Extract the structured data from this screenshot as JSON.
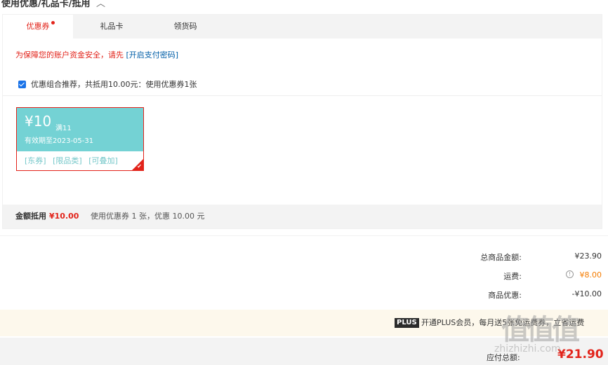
{
  "section": {
    "title": "使用优惠/礼品卡/抵用",
    "collapse_icon": "chevron-up-icon"
  },
  "tabs": [
    {
      "label": "优惠券",
      "active": true,
      "has_dot": true
    },
    {
      "label": "礼品卡",
      "active": false
    },
    {
      "label": "领货码",
      "active": false
    }
  ],
  "security_tip": {
    "text": "为保障您的账户资金安全，请先 ",
    "link": "[开启支付密码]"
  },
  "combo": {
    "checked": true,
    "text": "优惠组合推荐，共抵用10.00元：使用优惠券1张"
  },
  "coupon": {
    "amount": "¥10",
    "condition": "满11",
    "expire": "有效期至2023-05-31",
    "tags": [
      "[东券]",
      "[限品类]",
      "[可叠加]"
    ],
    "selected": true
  },
  "summary": {
    "label": "金额抵用",
    "amount": "¥10.00",
    "desc": "使用优惠券 1 张，优惠 10.00 元"
  },
  "totals": {
    "goods_label": "总商品金额:",
    "goods_value": "¥23.90",
    "shipping_label": "运费:",
    "shipping_value": "¥8.00",
    "discount_label": "商品优惠:",
    "discount_value": "-¥10.00"
  },
  "plus": {
    "badge": "PLUS",
    "text": "开通PLUS会员，每月送5张免运费券，立省运费"
  },
  "pay": {
    "label": "应付总额:",
    "value": "¥21.90"
  },
  "watermark": {
    "logo": "值值值",
    "url": "zhizhizhi.com"
  },
  "colors": {
    "accent": "#e2231a",
    "coupon_bg": "#74d2d4",
    "link": "#005ea7"
  }
}
